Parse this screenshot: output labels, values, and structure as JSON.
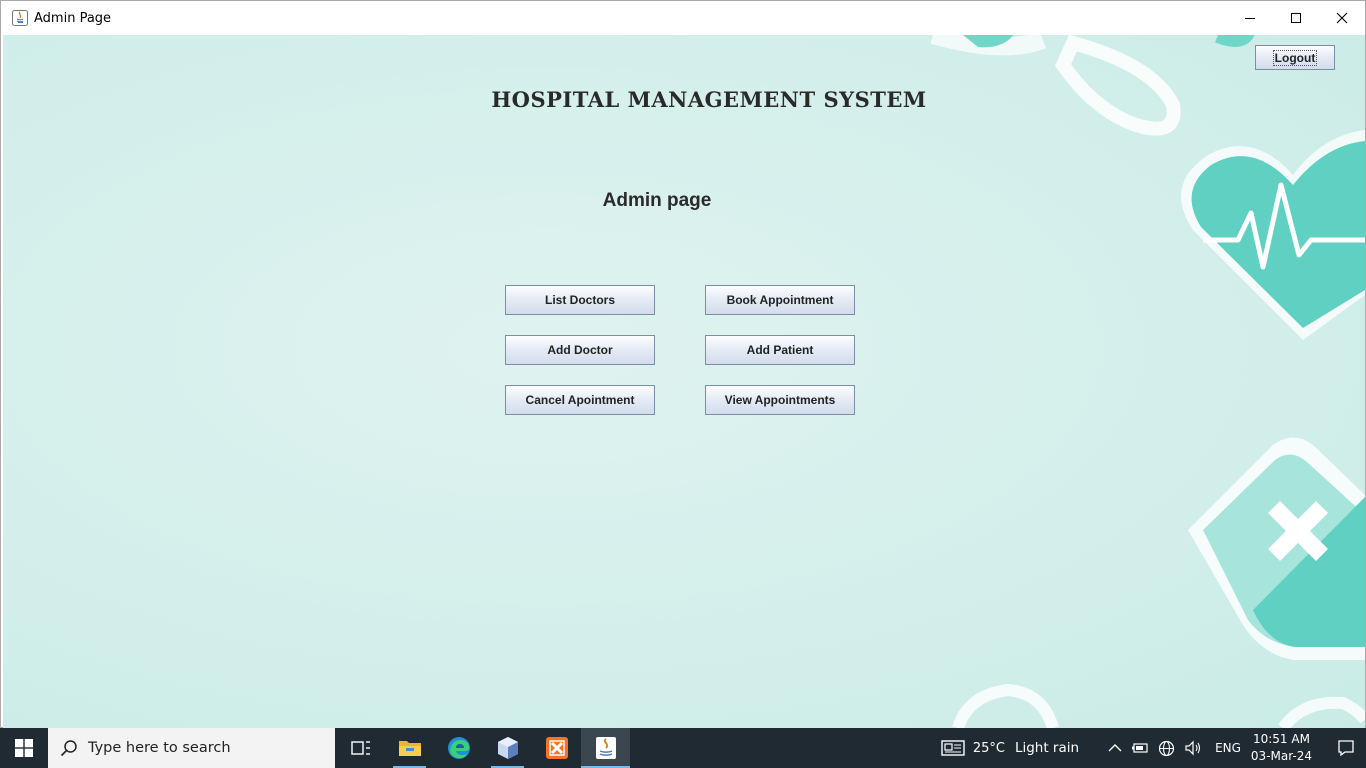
{
  "window": {
    "title": "Admin Page"
  },
  "header": {
    "title": "HOSPITAL MANAGEMENT SYSTEM",
    "subtitle": "Admin page",
    "logout_label": "Logout"
  },
  "actions": {
    "list_doctors": "List Doctors",
    "book_appointment": "Book Appointment",
    "add_doctor": "Add Doctor",
    "add_patient": "Add Patient",
    "cancel_appointment": "Cancel Apointment",
    "view_appointments": "View Appointments"
  },
  "taskbar": {
    "search_placeholder": "Type here to search",
    "pinned_icons": [
      "task-view-icon",
      "file-explorer-icon",
      "edge-icon",
      "virtualbox-icon",
      "xampp-icon",
      "java-icon"
    ],
    "weather_temp": "25°C",
    "weather_desc": "Light rain",
    "language": "ENG",
    "time": "10:51 AM",
    "date": "03-Mar-24"
  },
  "colors": {
    "background": "#d4efeb",
    "accent_teal": "#5fd0c2",
    "taskbar": "#1f2a33"
  }
}
